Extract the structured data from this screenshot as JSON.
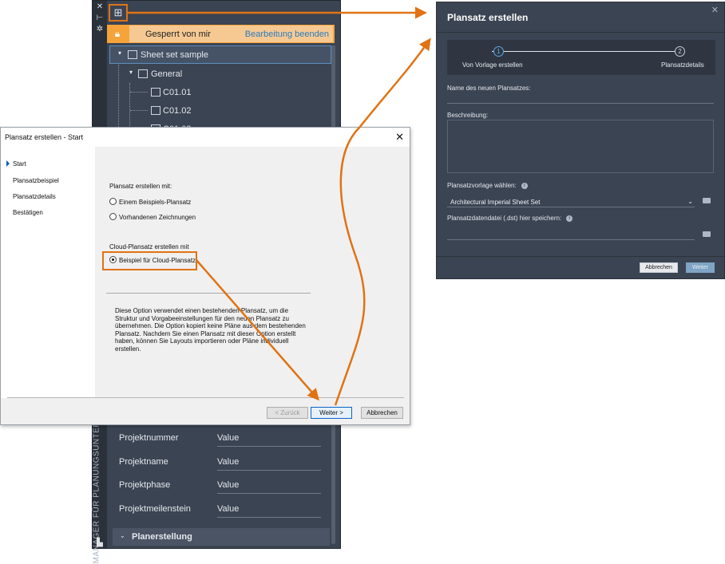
{
  "palette": {
    "strip_icons": [
      "close-icon",
      "pin-icon",
      "settings-icon"
    ],
    "vertical_title": "MANAGER FÜR PLANUNGSUNTERL",
    "lock": {
      "text": "Gesperrt von mir",
      "action": "Bearbeitung beenden"
    },
    "tree": {
      "root": "Sheet set sample",
      "group": "General",
      "sheets": [
        "C01.01",
        "C01.02",
        "C01.03"
      ]
    },
    "properties": [
      {
        "label": "Projektnummer",
        "value": "Value"
      },
      {
        "label": "Projektname",
        "value": "Value"
      },
      {
        "label": "Projektphase",
        "value": "Value"
      },
      {
        "label": "Projektmeilenstein",
        "value": "Value"
      }
    ],
    "section": "Planerstellung"
  },
  "webdlg": {
    "title": "Plansatz erstellen",
    "steps": [
      {
        "num": "1",
        "label": "Von Vorlage erstellen"
      },
      {
        "num": "2",
        "label": "Plansatzdetails"
      }
    ],
    "name_label": "Name des neuen Plansatzes:",
    "desc_label": "Beschreibung:",
    "template_label": "Plansatzvorlage wählen:",
    "template_value": "Architectural Imperial Sheet Set",
    "dst_label": "Plansatzdatendatei (.dst) hier speichern:",
    "cancel": "Abbrechen",
    "next": "Weiter"
  },
  "windlg": {
    "title": "Plansatz erstellen - Start",
    "nav": [
      "Start",
      "Plansatzbeispiel",
      "Plansatzdetails",
      "Bestätigen"
    ],
    "create_with": "Plansatz erstellen mit:",
    "option_example": "Einem Beispiels-Plansatz",
    "option_existing": "Vorhandenen Zeichnungen",
    "cloud_heading": "Cloud-Plansatz erstellen mit",
    "option_cloud": "Beispiel für Cloud-Plansatz",
    "help": "Diese Option verwendet einen bestehenden Plansatz, um die Struktur und Vorgabeeinstellungen für den neuen Plansatz zu übernehmen. Die Option kopiert keine Pläne aus dem bestehenden Plansatz. Nachdem Sie einen Plansatz mit dieser Option erstellt haben, können Sie Layouts importieren oder Pläne individuell erstellen.",
    "back": "< Zurück",
    "next": "Weiter >",
    "cancel": "Abbrechen"
  },
  "colors": {
    "accent_orange": "#e07314",
    "dark_panel": "#3b4453",
    "lock_bar": "#f4a43a",
    "link_blue": "#2a7bbd"
  }
}
